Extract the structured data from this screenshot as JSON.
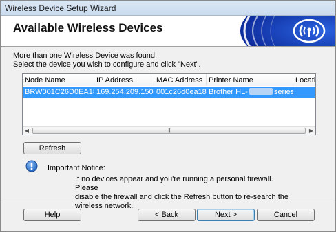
{
  "window": {
    "title": "Wireless Device Setup Wizard"
  },
  "header": {
    "heading": "Available Wireless Devices"
  },
  "intro": {
    "line1": "More than one Wireless Device was found.",
    "line2": "Select the device you wish to configure and click \"Next\"."
  },
  "device_list": {
    "columns": [
      "Node Name",
      "IP Address",
      "MAC Address",
      "Printer Name",
      "Location"
    ],
    "rows": [
      {
        "node_name": "BRW001C26D0EA18",
        "ip_address": "169.254.209.150",
        "mac_address": "001c26d0ea18",
        "printer_name_prefix": "Brother HL-",
        "printer_name_suffix": "series",
        "selected": true
      }
    ]
  },
  "buttons": {
    "refresh": "Refresh",
    "help": "Help",
    "back": "< Back",
    "next": "Next >",
    "cancel": "Cancel"
  },
  "notice": {
    "icon": "info-icon",
    "title": "Important Notice:",
    "line1": "If no devices appear and you're running a personal firewall. Please",
    "line2": "disable the firewall and click the Refresh button to re-search the",
    "line3": "wireless network."
  },
  "colors": {
    "selection": "#3399ff",
    "header_bg": "#ffffff",
    "brand_blue": "#1f4fc8"
  }
}
